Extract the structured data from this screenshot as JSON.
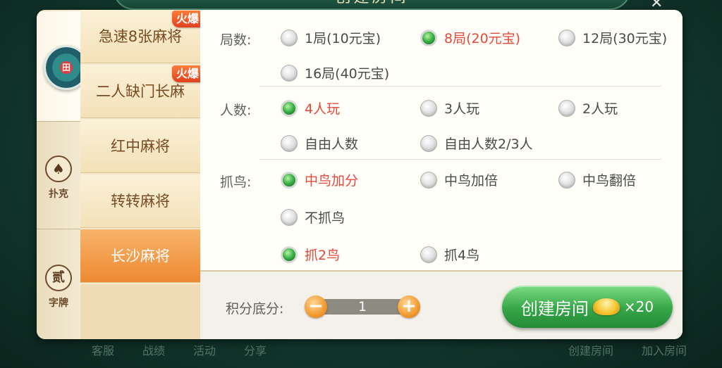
{
  "background": {
    "title": "创建房间",
    "bottom_nav": [
      "客服",
      "战绩",
      "活动",
      "分享",
      "创建房间",
      "加入房间"
    ]
  },
  "sidebar": {
    "categories": [
      {
        "label": "",
        "icon": "mahjong-emblem-icon"
      },
      {
        "label": "扑克",
        "icon": "spade-icon",
        "glyph": "♠"
      },
      {
        "label": "字牌",
        "icon": "zipai-icon",
        "glyph": "贰"
      }
    ]
  },
  "games": [
    {
      "label": "急速8张麻将",
      "badge": "火爆"
    },
    {
      "label": "二人缺门长麻",
      "badge": "火爆"
    },
    {
      "label": "红中麻将"
    },
    {
      "label": "转转麻将"
    },
    {
      "label": "长沙麻将",
      "active": true
    }
  ],
  "options": {
    "rounds": {
      "label": "局数:",
      "items": [
        "1局(10元宝)",
        "8局(20元宝)",
        "12局(30元宝)",
        "16局(40元宝)"
      ],
      "selected": "8局(20元宝)"
    },
    "players": {
      "label": "人数:",
      "items": [
        "4人玩",
        "3人玩",
        "2人玩",
        "自由人数",
        "自由人数2/3人"
      ],
      "selected": "4人玩"
    },
    "birds": {
      "label": "抓鸟:",
      "items": [
        "中鸟加分",
        "中鸟加倍",
        "中鸟翻倍",
        "不抓鸟",
        "抓2鸟",
        "抓4鸟"
      ],
      "selected": [
        "中鸟加分",
        "抓2鸟"
      ]
    }
  },
  "footer": {
    "score_label": "积分底分:",
    "score_value": "1",
    "minus": "−",
    "plus": "+",
    "create_label": "创建房间",
    "cost": "×20"
  }
}
